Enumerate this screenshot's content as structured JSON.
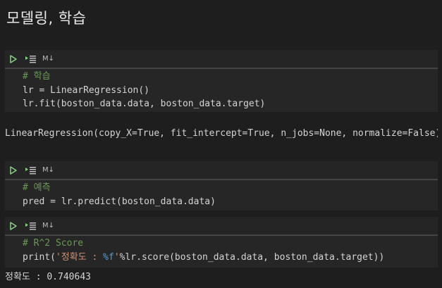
{
  "heading": "모델링, 학습",
  "colors": {
    "background": "#1e1e1e",
    "toolbar": "#252526",
    "editor": "#262626",
    "comment": "#6a9955",
    "string": "#ce9178",
    "format": "#569cd6",
    "run_icon": "#89d185"
  },
  "cells": [
    {
      "toolbar": {
        "run_icon": "run-triangle",
        "runby_icon": "run-by-line",
        "badge": "M↓"
      },
      "lines": {
        "l1_comment": "# 학습",
        "l2": "lr = LinearRegression()",
        "l3": "lr.fit(boston_data.data, boston_data.target)"
      },
      "output": "LinearRegression(copy_X=True, fit_intercept=True, n_jobs=None, normalize=False)"
    },
    {
      "toolbar": {
        "run_icon": "run-triangle",
        "runby_icon": "run-by-line",
        "badge": "M↓"
      },
      "lines": {
        "l1_comment": "# 예측",
        "l2": "pred = lr.predict(boston_data.data)"
      }
    },
    {
      "toolbar": {
        "run_icon": "run-triangle",
        "runby_icon": "run-by-line",
        "badge": "M↓"
      },
      "lines": {
        "l1_comment": "# R^2 Score",
        "l2_print": "print(",
        "l2_str_open": "'정확도 : ",
        "l2_fmt": "%f",
        "l2_str_close": "'",
        "l2_rest": "%lr.score(boston_data.data, boston_data.target))"
      },
      "output": "정확도 : 0.740643"
    }
  ]
}
